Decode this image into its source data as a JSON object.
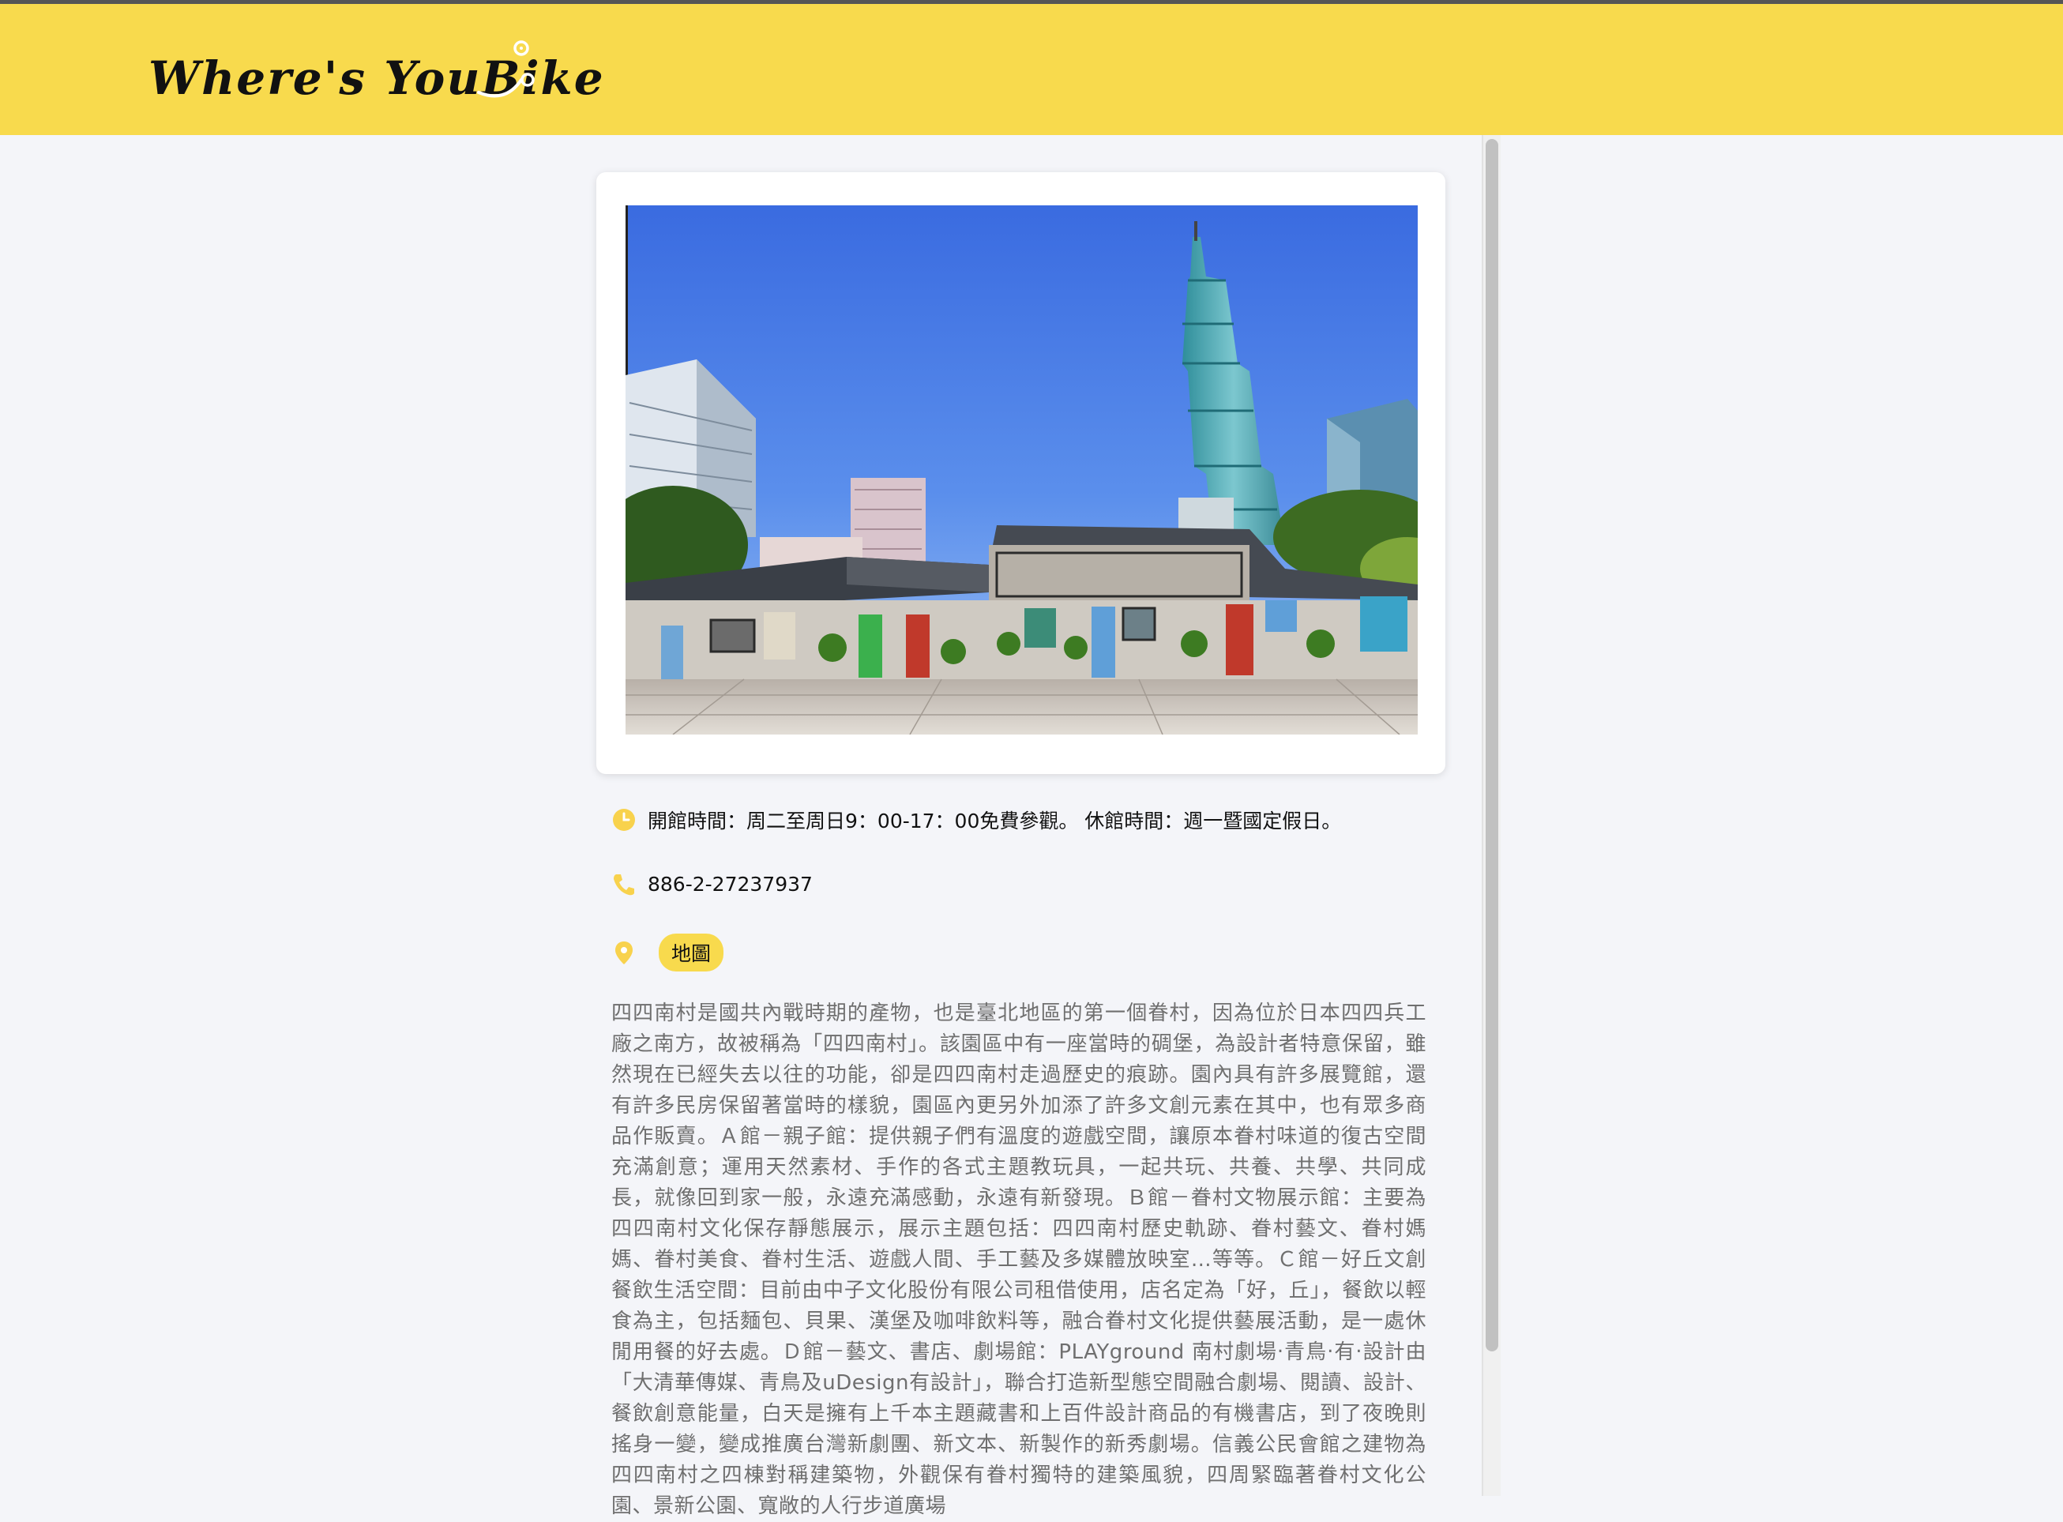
{
  "header": {
    "logo_text": "Where's YouBike",
    "bg_color": "#f8da4d"
  },
  "photo": {
    "alt": "四四南村與台北101",
    "icon": "photo"
  },
  "info": {
    "hours_icon": "clock-icon",
    "hours": "開館時間：周二至周日9：00-17：00免費參觀。 休館時間：週一暨國定假日。",
    "phone_icon": "phone-icon",
    "phone": "886-2-27237937",
    "map_icon": "map-pin-icon",
    "map_label": "地圖"
  },
  "description": "四四南村是國共內戰時期的產物，也是臺北地區的第一個眷村，因為位於日本四四兵工廠之南方，故被稱為「四四南村」。該園區中有一座當時的碉堡，為設計者特意保留，雖然現在已經失去以往的功能，卻是四四南村走過歷史的痕跡。園內具有許多展覽館，還有許多民房保留著當時的樣貌，園區內更另外加添了許多文創元素在其中，也有眾多商品作販賣。Ａ館－親子館：提供親子們有溫度的遊戲空間，讓原本眷村味道的復古空間充滿創意；運用天然素材、手作的各式主題教玩具，一起共玩、共養、共學、共同成長，就像回到家一般，永遠充滿感動，永遠有新發現。Ｂ館－眷村文物展示館：主要為四四南村文化保存靜態展示，展示主題包括：四四南村歷史軌跡、眷村藝文、眷村媽媽、眷村美食、眷村生活、遊戲人間、手工藝及多媒體放映室…等等。Ｃ館－好丘文創餐飲生活空間：目前由中子文化股份有限公司租借使用，店名定為「好，丘」，餐飲以輕食為主，包括麵包、貝果、漢堡及咖啡飲料等，融合眷村文化提供藝展活動，是一處休閒用餐的好去處。Ｄ館－藝文、書店、劇場館：PLAYground 南村劇場‧青鳥‧有‧設計由「大清華傳媒、青鳥及uDesign有設計」，聯合打造新型態空間融合劇場、閱讀、設計、餐飲創意能量，白天是擁有上千本主題藏書和上百件設計商品的有機書店，到了夜晚則搖身一變，變成推廣台灣新劇團、新文本、新製作的新秀劇場。信義公民會館之建物為四四南村之四棟對稱建築物，外觀保有眷村獨特的建築風貌，四周緊臨著眷村文化公園、景新公園、寬敞的人行步道廣場"
}
